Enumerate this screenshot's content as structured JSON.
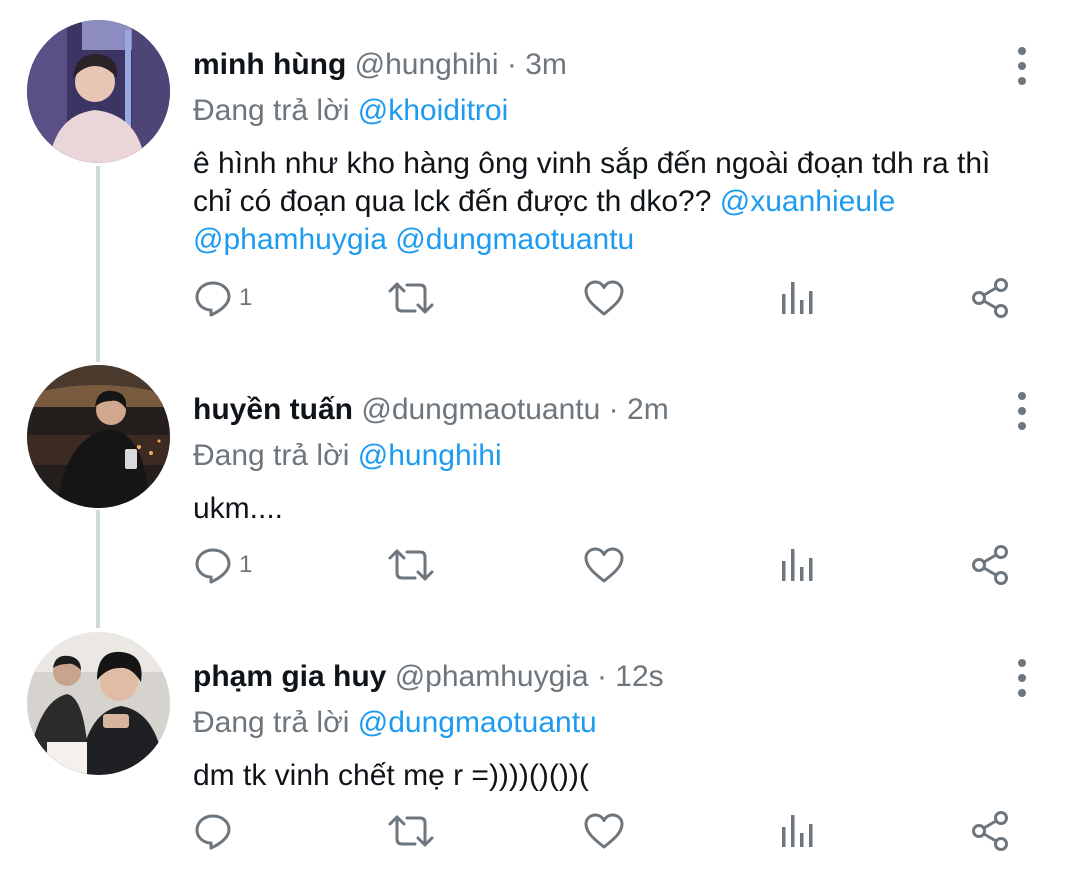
{
  "tweets": [
    {
      "name": "minh hùng",
      "handle": "@hunghihi",
      "separator": "·",
      "time": "3m",
      "replying_prefix": "Đang trả lời",
      "replying_to": "@khoiditroi",
      "text_plain": "ê hình như kho hàng ông vinh sắp đến ngoài đoạn tdh ra thì chỉ có đoạn qua lck đến được th dko??",
      "mentions": [
        "@xuanhieule",
        "@phamhuygia",
        "@dungmaotuantu"
      ],
      "reply_count": "1"
    },
    {
      "name": "huyền tuấn",
      "handle": "@dungmaotuantu",
      "separator": "·",
      "time": "2m",
      "replying_prefix": "Đang trả lời",
      "replying_to": "@hunghihi",
      "text_plain": "ukm....",
      "reply_count": "1"
    },
    {
      "name": "phạm gia huy",
      "handle": "@phamhuygia",
      "separator": "·",
      "time": "12s",
      "replying_prefix": "Đang trả lời",
      "replying_to": "@dungmaotuantu",
      "text_plain": "dm tk vinh chết mẹ r =))))()())(",
      "reply_count": ""
    }
  ],
  "icons": {
    "reply": "reply-icon",
    "retweet": "retweet-icon",
    "like": "heart-icon",
    "analytics": "analytics-icon",
    "share": "share-icon",
    "menu": "more-vertical-icon"
  },
  "colors": {
    "text": "#0f1419",
    "secondary": "#6e767d",
    "accent": "#1d9bf0",
    "thread_line": "#cfd9de"
  }
}
